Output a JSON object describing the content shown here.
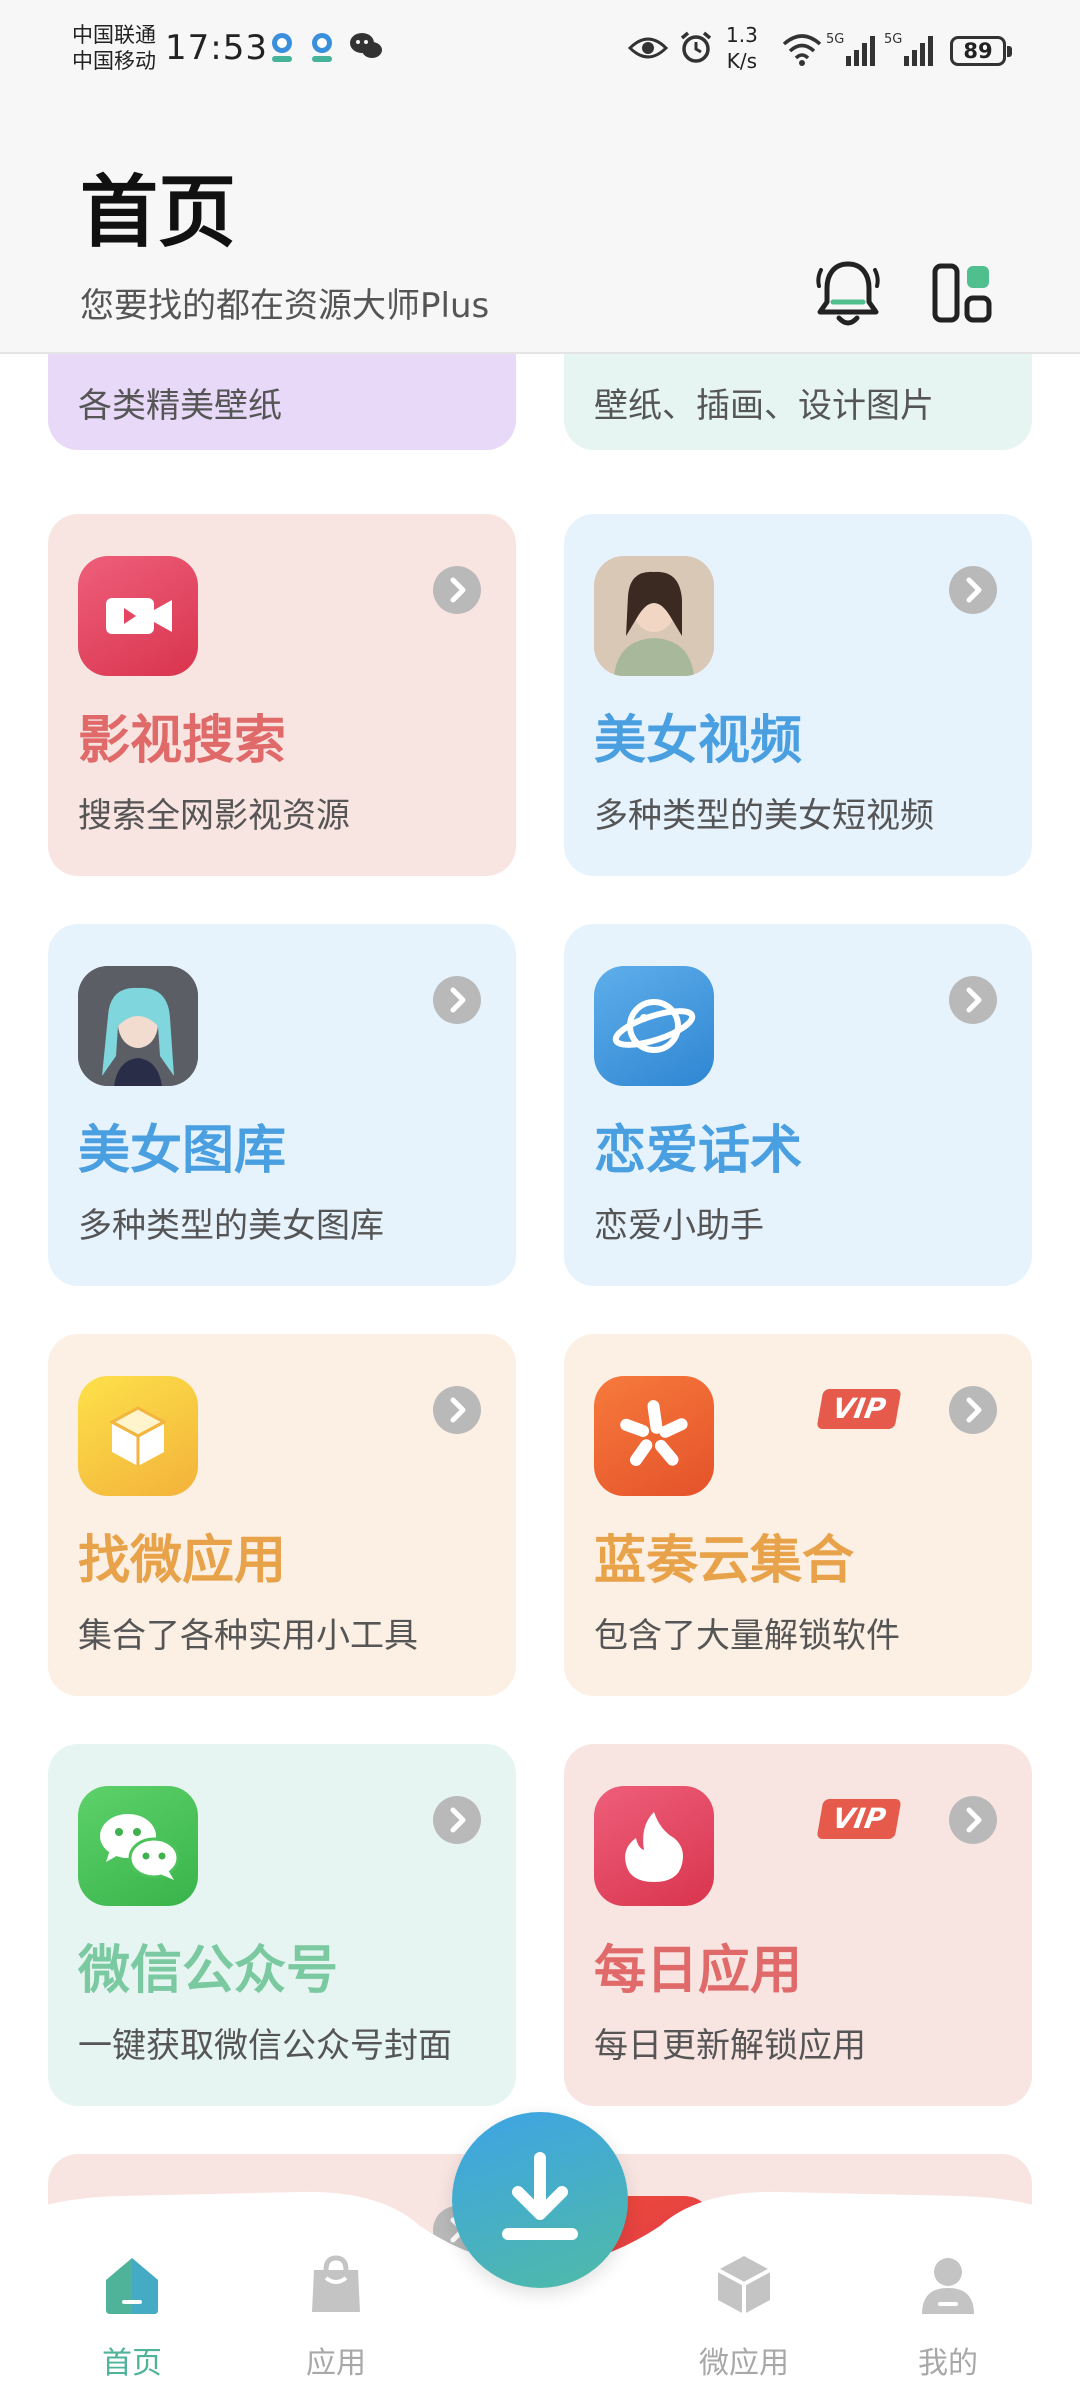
{
  "status_bar": {
    "carrier1": "中国联通",
    "carrier2": "中国移动",
    "time": "17:53",
    "speed_value": "1.3",
    "speed_unit": "K/s",
    "battery": "89"
  },
  "header": {
    "title": "首页",
    "subtitle": "您要找的都在资源大师Plus"
  },
  "top_partial": {
    "left_desc": "各类精美壁纸",
    "right_desc": "壁纸、插画、设计图片"
  },
  "cards": [
    {
      "title": "影视搜索",
      "desc": "搜索全网影视资源",
      "icon": "video-camera-icon",
      "title_color": "#e06a6a",
      "bg": "#f8e5e2",
      "vip": false
    },
    {
      "title": "美女视频",
      "desc": "多种类型的美女短视频",
      "icon": "photo-thumbnail-icon",
      "title_color": "#4a9fe0",
      "bg": "#e6f3fd",
      "vip": false
    },
    {
      "title": "美女图库",
      "desc": "多种类型的美女图库",
      "icon": "photo-thumbnail-icon",
      "title_color": "#4a9fe0",
      "bg": "#e6f3fd",
      "vip": false
    },
    {
      "title": "恋爱话术",
      "desc": "恋爱小助手",
      "icon": "planet-icon",
      "title_color": "#4a9fe0",
      "bg": "#e6f3fd",
      "vip": false
    },
    {
      "title": "找微应用",
      "desc": "集合了各种实用小工具",
      "icon": "cube-icon",
      "title_color": "#e8a24a",
      "bg": "#fcefe3",
      "vip": false
    },
    {
      "title": "蓝奏云集合",
      "desc": "包含了大量解锁软件",
      "icon": "yelp-star-icon",
      "title_color": "#e8a24a",
      "bg": "#fcefe3",
      "vip": true
    },
    {
      "title": "微信公众号",
      "desc": "一键获取微信公众号封面",
      "icon": "wechat-icon",
      "title_color": "#7bc9a0",
      "bg": "#e6f5f1",
      "vip": false
    },
    {
      "title": "每日应用",
      "desc": "每日更新解锁应用",
      "icon": "tinder-flame-icon",
      "title_color": "#e06a6a",
      "bg": "#f8e5e2",
      "vip": true
    }
  ],
  "vip_label": "VIP",
  "bottom_nav": {
    "home": "首页",
    "apps": "应用",
    "micro_apps": "微应用",
    "mine": "我的"
  }
}
